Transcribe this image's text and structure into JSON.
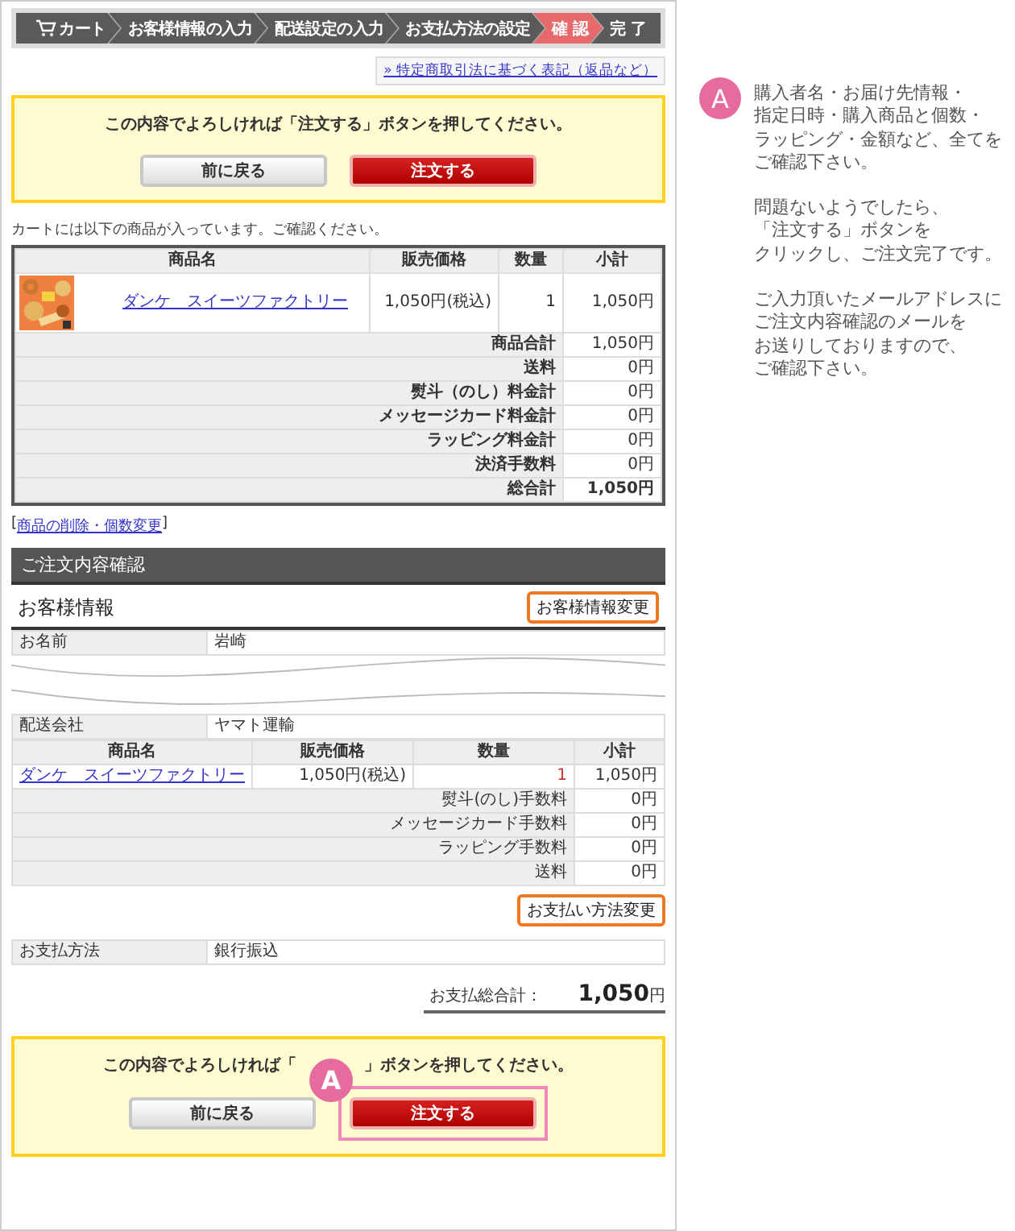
{
  "steps": [
    {
      "label": "カート",
      "kind": "cart",
      "selected": false
    },
    {
      "label": "お客様情報の入力",
      "kind": "step",
      "selected": false
    },
    {
      "label": "配送設定の入力",
      "kind": "step",
      "selected": false
    },
    {
      "label": "お支払方法の設定",
      "kind": "step",
      "selected": false
    },
    {
      "label": "確 認",
      "kind": "step",
      "selected": true
    },
    {
      "label": "完 了",
      "kind": "step",
      "selected": false
    }
  ],
  "legal_link": "» 特定商取引法に基づく表記（返品など）",
  "confirm_top": {
    "message": "この内容でよろしければ「注文する」ボタンを押してください。",
    "back_button": "前に戻る",
    "order_button": "注文する"
  },
  "cart_note": "カートには以下の商品が入っています。ご確認ください。",
  "cart_table": {
    "columns": [
      "商品名",
      "販売価格",
      "数量",
      "小計"
    ],
    "rows": [
      {
        "product": "ダンケ　スイーツファクトリー",
        "price": "1,050円(税込)",
        "quantity": "1",
        "subtotal": "1,050円"
      }
    ],
    "totals": [
      {
        "label": "商品合計",
        "value": "1,050円",
        "kind": "line"
      },
      {
        "label": "送料",
        "value": "0円",
        "kind": "line"
      },
      {
        "label": "熨斗（のし）料金計",
        "value": "0円",
        "kind": "line"
      },
      {
        "label": "メッセージカード料金計",
        "value": "0円",
        "kind": "line"
      },
      {
        "label": "ラッピング料金計",
        "value": "0円",
        "kind": "line"
      },
      {
        "label": "決済手数料",
        "value": "0円",
        "kind": "line"
      },
      {
        "label": "総合計",
        "value": "1,050円",
        "kind": "grand"
      }
    ]
  },
  "edit_link": {
    "open": "[",
    "label": "商品の削除・個数変更",
    "close": "]"
  },
  "order_section": {
    "title": "ご注文内容確認",
    "customer": {
      "heading": "お客様情報",
      "edit_button": "お客様情報変更",
      "rows": [
        {
          "label": "お名前",
          "value": "岩崎"
        }
      ]
    },
    "shipping_rows": [
      {
        "label": "配送会社",
        "value": "ヤマト運輸"
      }
    ],
    "items_table": {
      "columns": [
        "商品名",
        "販売価格",
        "数量",
        "小計"
      ],
      "rows": [
        {
          "product": "ダンケ　スイーツファクトリー",
          "price": "1,050円(税込)",
          "quantity": "1",
          "subtotal": "1,050円"
        }
      ],
      "fees": [
        {
          "label": "熨斗(のし)手数料",
          "value": "0円"
        },
        {
          "label": "メッセージカード手数料",
          "value": "0円"
        },
        {
          "label": "ラッピング手数料",
          "value": "0円"
        },
        {
          "label": "送料",
          "value": "0円"
        }
      ]
    },
    "payment_edit_button": "お支払い方法変更",
    "payment_rows": [
      {
        "label": "お支払方法",
        "value": "銀行振込"
      }
    ],
    "total": {
      "label": "お支払総合計：",
      "amount": "1,050",
      "unit": "円"
    }
  },
  "confirm_bottom": {
    "message_before": "この内容でよろしければ「",
    "message_after": "」ボタンを押してください。",
    "back_button": "前に戻る",
    "order_button": "注文する",
    "marker": "A"
  },
  "annotation": {
    "marker": "A",
    "paragraphs": [
      {
        "lines": [
          "購入者名・お届け先情報・",
          "指定日時・購入商品と個数・",
          "ラッピング・金額など、全てを",
          "ご確認下さい。"
        ]
      },
      {
        "lines": [
          "問題ないようでしたら、",
          "「注文する」ボタンを",
          "クリックし、ご注文完了です。"
        ]
      },
      {
        "lines": [
          "ご入力頂いたメールアドレスに",
          "ご注文内容確認のメールを",
          "お送りしておりますので、",
          "ご確認下さい。"
        ]
      }
    ]
  }
}
